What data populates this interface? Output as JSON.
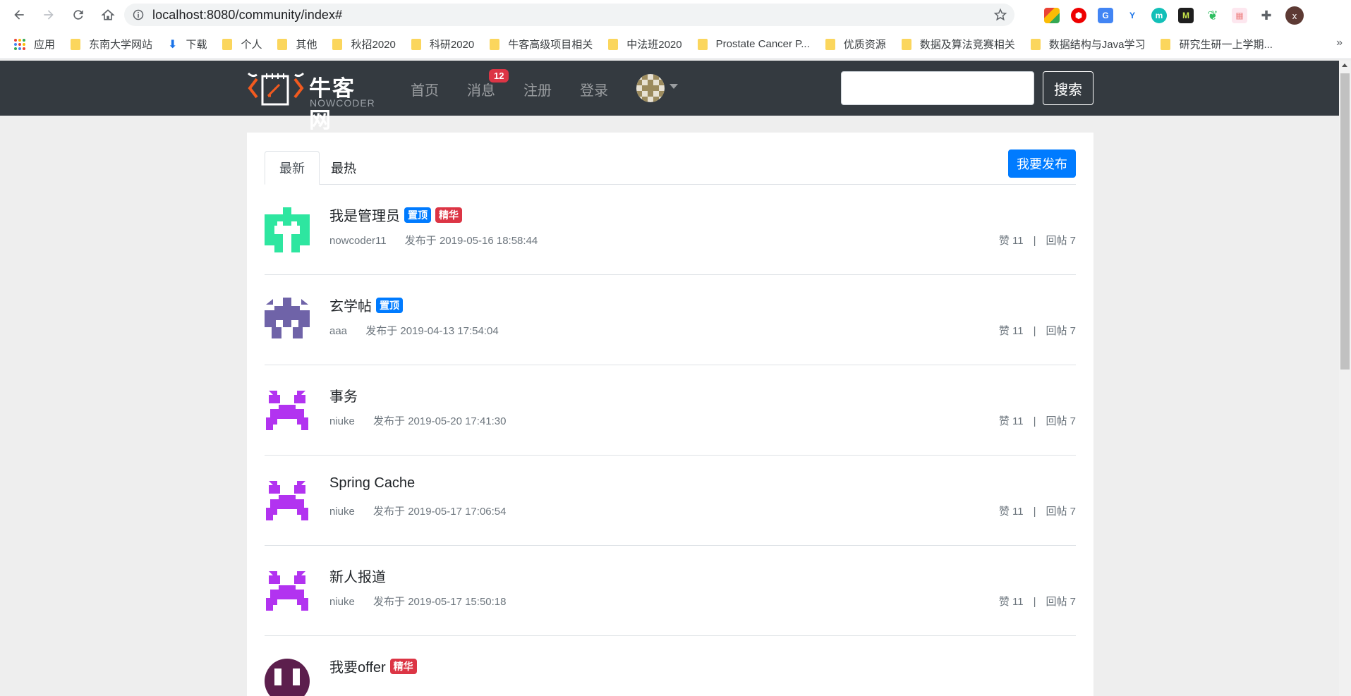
{
  "browser": {
    "url": "localhost:8080/community/index#",
    "profile_initial": "x",
    "bookmarks": [
      {
        "label": "应用",
        "kind": "apps"
      },
      {
        "label": "东南大学网站",
        "kind": "folder"
      },
      {
        "label": "下载",
        "kind": "download"
      },
      {
        "label": "个人",
        "kind": "folder"
      },
      {
        "label": "其他",
        "kind": "folder"
      },
      {
        "label": "秋招2020",
        "kind": "folder"
      },
      {
        "label": "科研2020",
        "kind": "folder"
      },
      {
        "label": "牛客高级项目相关",
        "kind": "folder"
      },
      {
        "label": "中法班2020",
        "kind": "folder"
      },
      {
        "label": "Prostate Cancer P...",
        "kind": "folder"
      },
      {
        "label": "优质资源",
        "kind": "folder"
      },
      {
        "label": "数据及算法竞赛相关",
        "kind": "folder"
      },
      {
        "label": "数据结构与Java学习",
        "kind": "folder"
      },
      {
        "label": "研究生研一上学期...",
        "kind": "folder"
      }
    ],
    "more": "»"
  },
  "site": {
    "logo_cn": "牛客网",
    "logo_en": "NOWCODER",
    "nav": {
      "home": "首页",
      "messages": "消息",
      "message_count": "12",
      "register": "注册",
      "login": "登录"
    },
    "search_button": "搜索",
    "search_value": ""
  },
  "tabs": {
    "latest": "最新",
    "hottest": "最热",
    "publish": "我要发布"
  },
  "posts": [
    {
      "title": "我是管理员",
      "tags": [
        "置顶",
        "精华"
      ],
      "author": "nowcoder11",
      "time": "发布于 2019-05-16 18:58:44",
      "likes": "赞 11",
      "replies": "回帖 7",
      "avatar_color": "#2ee6a0"
    },
    {
      "title": "玄学帖",
      "tags": [
        "置顶"
      ],
      "author": "aaa",
      "time": "发布于 2019-04-13 17:54:04",
      "likes": "赞 11",
      "replies": "回帖 7",
      "avatar_color": "#6f63a8"
    },
    {
      "title": "事务",
      "tags": [],
      "author": "niuke",
      "time": "发布于 2019-05-20 17:41:30",
      "likes": "赞 11",
      "replies": "回帖 7",
      "avatar_color": "#b233f0"
    },
    {
      "title": "Spring Cache",
      "tags": [],
      "author": "niuke",
      "time": "发布于 2019-05-17 17:06:54",
      "likes": "赞 11",
      "replies": "回帖 7",
      "avatar_color": "#b233f0"
    },
    {
      "title": "新人报道",
      "tags": [],
      "author": "niuke",
      "time": "发布于 2019-05-17 15:50:18",
      "likes": "赞 11",
      "replies": "回帖 7",
      "avatar_color": "#b233f0"
    },
    {
      "title": "我要offer",
      "tags": [
        "精华"
      ],
      "author": "",
      "time": "",
      "likes": "",
      "replies": "",
      "avatar_color": "#5c1f4d"
    }
  ],
  "colors": {
    "navbar": "#343a40",
    "primary": "#007bff",
    "danger": "#dc3545",
    "logo_orange": "#f25a1f"
  }
}
